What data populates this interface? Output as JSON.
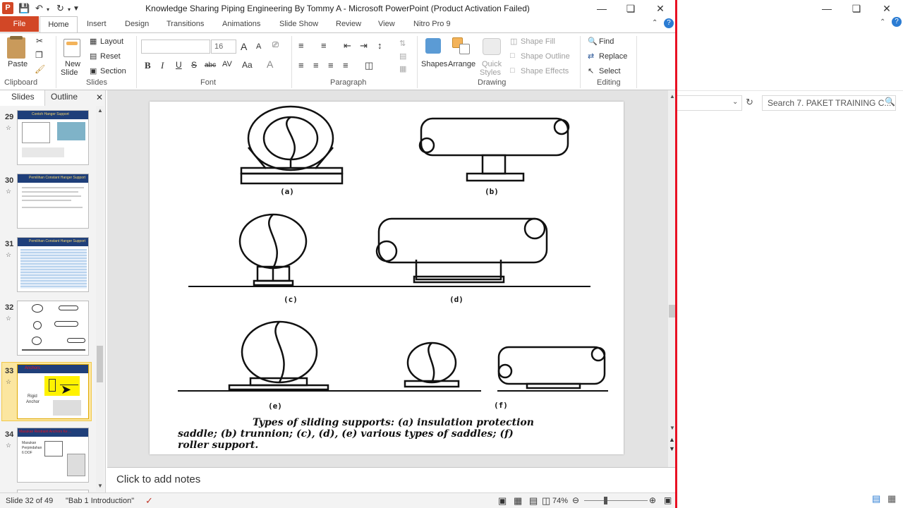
{
  "window": {
    "title": "Knowledge Sharing Piping Engineering By Tommy A  -  Microsoft PowerPoint (Product Activation Failed)",
    "app_icon_letter": "P",
    "accent_color": "#d24726"
  },
  "tabs": [
    "File",
    "Home",
    "Insert",
    "Design",
    "Transitions",
    "Animations",
    "Slide Show",
    "Review",
    "View",
    "Nitro Pro 9"
  ],
  "ribbon": {
    "clipboard": {
      "label": "Clipboard",
      "paste": "Paste"
    },
    "slides": {
      "label": "Slides",
      "new_slide_1": "New",
      "new_slide_2": "Slide",
      "layout": "Layout",
      "reset": "Reset",
      "section": "Section"
    },
    "font": {
      "label": "Font",
      "font_size": "16",
      "bold": "B",
      "italic": "I",
      "underline": "U",
      "strike": "S",
      "shadow": "abc",
      "spacing": "AV",
      "case": "Aa",
      "grow": "A",
      "shrink": "A"
    },
    "paragraph": {
      "label": "Paragraph"
    },
    "drawing": {
      "label": "Drawing",
      "shapes": "Shapes",
      "arrange": "Arrange",
      "quick_styles_1": "Quick",
      "quick_styles_2": "Styles",
      "shape_fill": "Shape Fill",
      "shape_outline": "Shape Outline",
      "shape_effects": "Shape Effects"
    },
    "editing": {
      "label": "Editing",
      "find": "Find",
      "replace": "Replace",
      "select": "Select"
    }
  },
  "left_pane": {
    "tab_slides": "Slides",
    "tab_outline": "Outline",
    "thumbnails": [
      {
        "num": "29",
        "title": "Contoh Hanger Support"
      },
      {
        "num": "30",
        "title": "Pemilihan Constant Hanger Support"
      },
      {
        "num": "31",
        "title": "Pemilihan Constant Hanger Support"
      },
      {
        "num": "32",
        "title": ""
      },
      {
        "num": "33",
        "title": "Anchors",
        "body_1": "Rigid",
        "body_2": "Anchor"
      },
      {
        "num": "34",
        "title": "Masukan Restraint Anchors Ke ...",
        "body_1": "Masukan",
        "body_2": "Perpindahan",
        "body_3": "6 DOF"
      }
    ]
  },
  "slide": {
    "labels": [
      "(a)",
      "(b)",
      "(c)",
      "(d)",
      "(e)",
      "(f)"
    ],
    "caption_1": "Types of sliding supports: (a) insulation protection",
    "caption_2": "saddle; (b) trunnion; (c), (d), (e) various types of saddles; (f)",
    "caption_3": "roller support."
  },
  "notes": {
    "placeholder": "Click to add notes"
  },
  "status": {
    "slide_pos": "Slide 32 of 49",
    "theme": "\"Bab 1 Introduction\"",
    "zoom": "74%"
  },
  "explorer": {
    "search_placeholder": "Search 7. PAKET TRAINING C..."
  }
}
